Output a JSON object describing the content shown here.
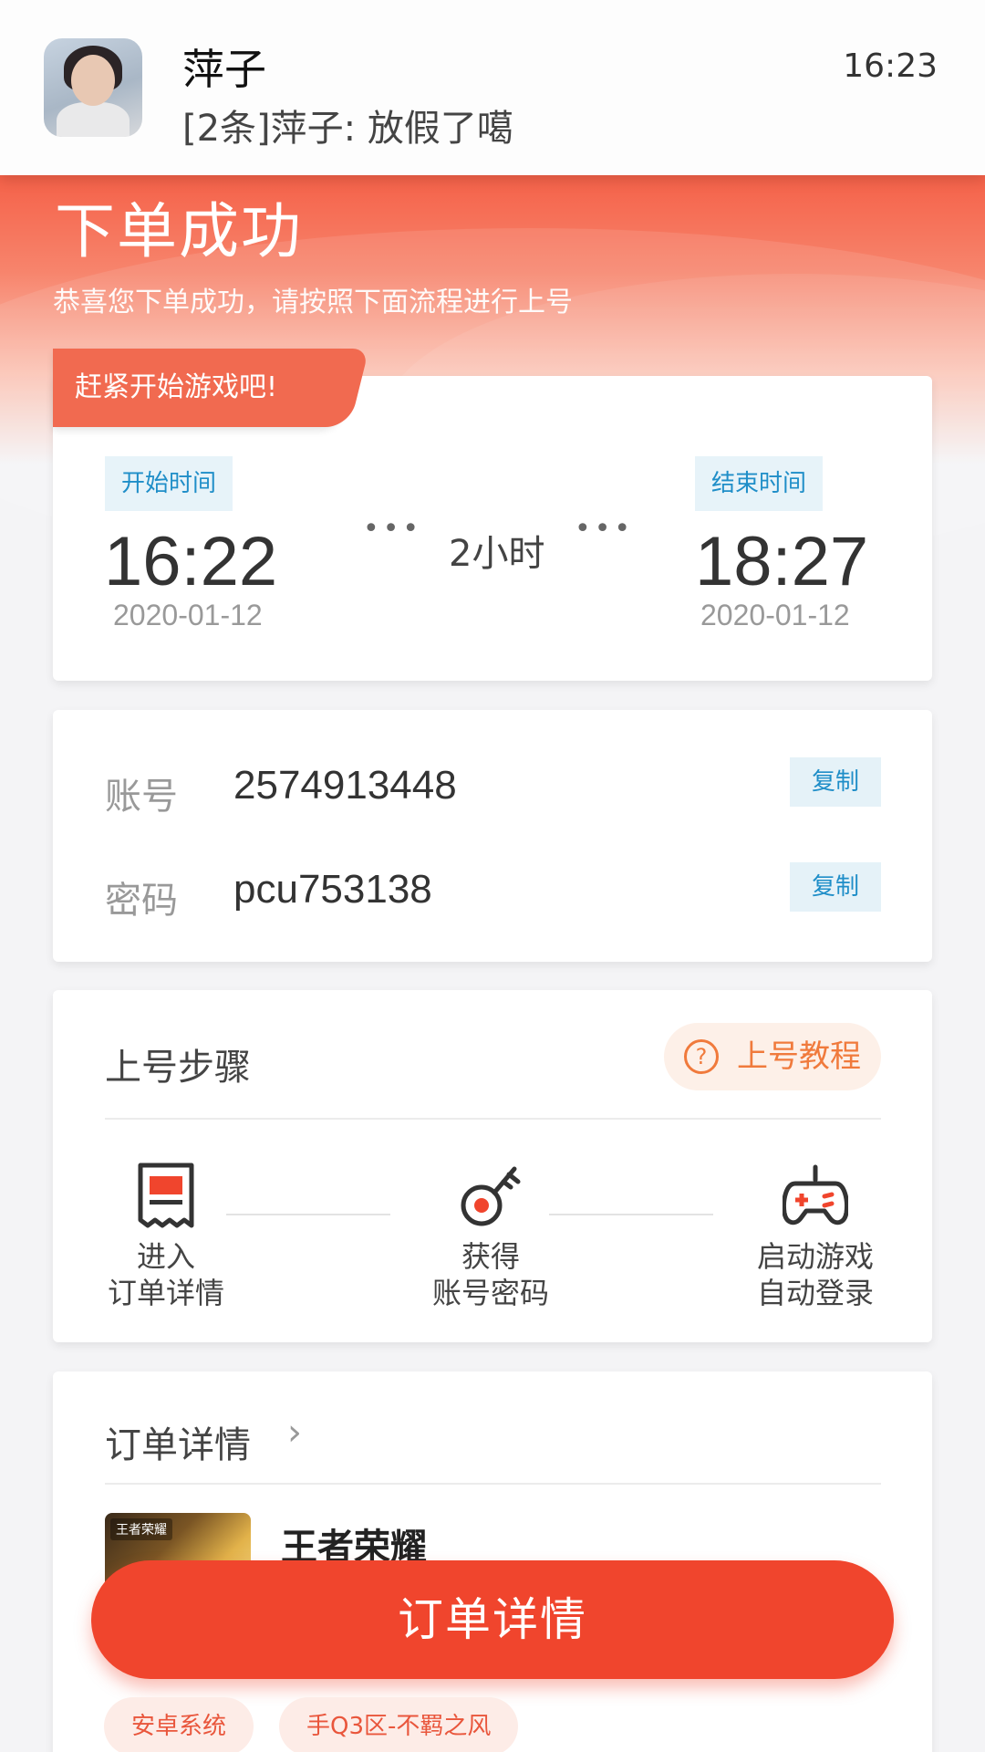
{
  "notification": {
    "sender": "萍子",
    "message": "[2条]萍子: 放假了噶",
    "time": "16:23"
  },
  "header": {
    "title": "下单成功",
    "subtitle": "恭喜您下单成功，请按照下面流程进行上号"
  },
  "time_card": {
    "ribbon": "赶紧开始游戏吧!",
    "start_label": "开始时间",
    "start_time": "16:22",
    "start_date": "2020-01-12",
    "dots": "•••",
    "duration": "2小时",
    "end_label": "结束时间",
    "end_time": "18:27",
    "end_date": "2020-01-12"
  },
  "account_card": {
    "account_label": "账号",
    "account_value": "2574913448",
    "password_label": "密码",
    "password_value": "pcu753138",
    "copy_label": "复制"
  },
  "steps_card": {
    "title": "上号步骤",
    "tutorial_label": "上号教程",
    "tutorial_icon": "?",
    "steps": [
      {
        "line1": "进入",
        "line2": "订单详情",
        "icon": "receipt-icon"
      },
      {
        "line1": "获得",
        "line2": "账号密码",
        "icon": "key-icon"
      },
      {
        "line1": "启动游戏",
        "line2": "自动登录",
        "icon": "gamepad-icon"
      }
    ]
  },
  "order_card": {
    "title": "订单详情",
    "chevron": "›",
    "game_name": "王者荣耀",
    "thumb_logo": "王者荣耀",
    "tags": [
      "安卓系统",
      "手Q3区-不羁之风"
    ]
  },
  "bottom_button": {
    "label": "订单详情"
  },
  "colors": {
    "accent": "#f0452d",
    "tag_blue": "#1f8ec8",
    "tutorial_orange": "#f07a3c"
  }
}
